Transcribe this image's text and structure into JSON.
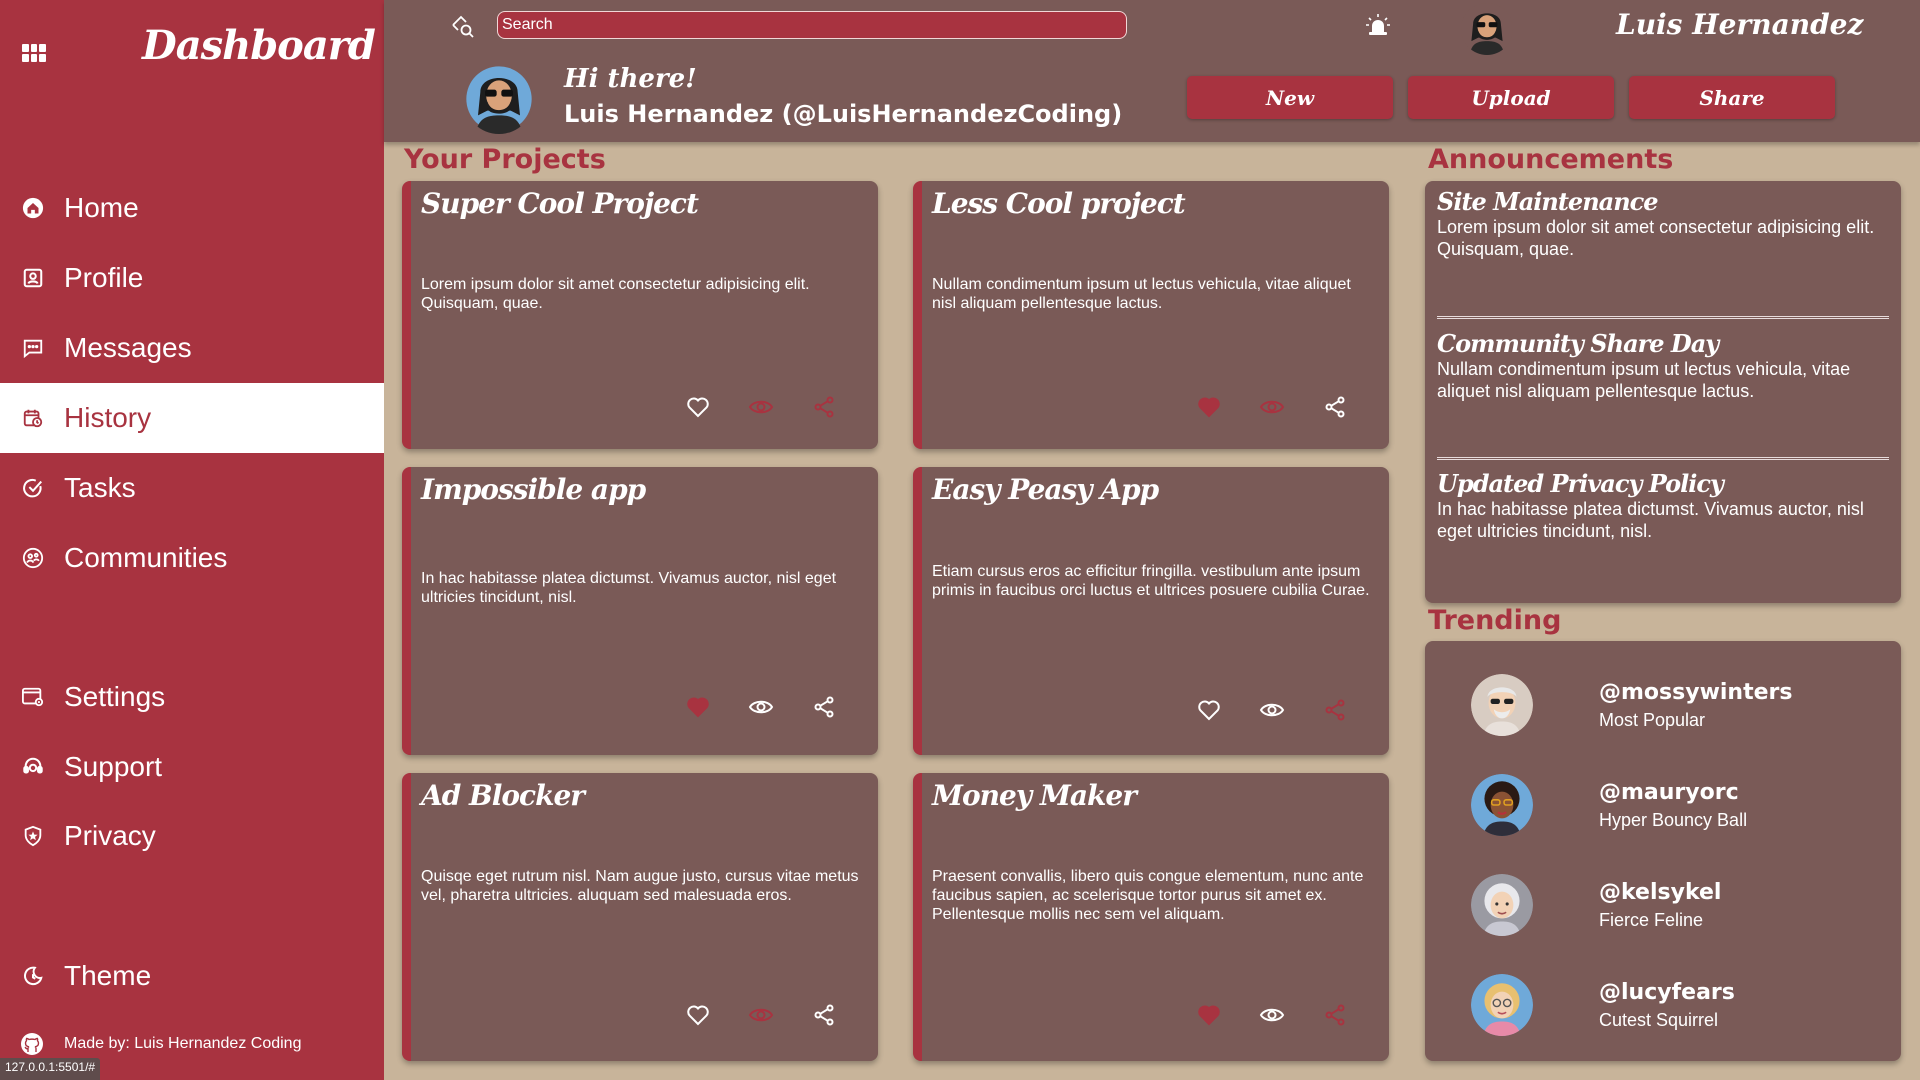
{
  "brand": {
    "title": "Dashboard"
  },
  "sidebar": {
    "items": [
      {
        "label": "Home",
        "icon": "home-icon"
      },
      {
        "label": "Profile",
        "icon": "profile-icon"
      },
      {
        "label": "Messages",
        "icon": "messages-icon"
      },
      {
        "label": "History",
        "icon": "history-icon",
        "active": true
      },
      {
        "label": "Tasks",
        "icon": "tasks-icon"
      },
      {
        "label": "Communities",
        "icon": "communities-icon"
      },
      {
        "label": "Settings",
        "icon": "settings-icon"
      },
      {
        "label": "Support",
        "icon": "support-icon"
      },
      {
        "label": "Privacy",
        "icon": "privacy-icon"
      },
      {
        "label": "Theme",
        "icon": "theme-icon"
      }
    ],
    "footer": "Made by: Luis Hernandez Coding"
  },
  "status_url": "127.0.0.1:5501/#",
  "header": {
    "search_placeholder": "Search",
    "user_name": "Luis Hernandez",
    "greeting": "Hi there!",
    "full_name": "Luis Hernandez (@LuisHernandezCoding)",
    "buttons": {
      "new": "New",
      "upload": "Upload",
      "share": "Share"
    }
  },
  "colors": {
    "accent": "#a83340",
    "panel": "#7a5a57",
    "background": "#c8b49a"
  },
  "projects": {
    "title": "Your Projects",
    "items": [
      {
        "title": "Super Cool Project",
        "description": "Lorem ipsum dolor sit amet consectetur adipisicing elit. Quisquam, quae.",
        "liked": false,
        "watched": true,
        "shared": true
      },
      {
        "title": "Less Cool project",
        "description": "Nullam condimentum ipsum ut lectus vehicula, vitae aliquet nisl aliquam pellentesque lactus.",
        "liked": true,
        "watched": true,
        "shared": false
      },
      {
        "title": "Impossible app",
        "description": "In hac habitasse platea dictumst. Vivamus auctor, nisl eget ultricies tincidunt, nisl.",
        "liked": true,
        "watched": false,
        "shared": false
      },
      {
        "title": "Easy Peasy App",
        "description": "Etiam cursus eros ac efficitur fringilla. vestibulum ante ipsum primis in faucibus orci luctus et ultrices posuere cubilia Curae.",
        "liked": false,
        "watched": false,
        "shared": true
      },
      {
        "title": "Ad Blocker",
        "description": "Quisqe eget rutrum nisl. Nam augue justo, cursus vitae metus vel, pharetra ultricies. aluquam sed malesuada eros.",
        "liked": false,
        "watched": true,
        "shared": false
      },
      {
        "title": "Money Maker",
        "description": "Praesent convallis, libero quis congue elementum, nunc ante faucibus sapien, ac scelerisque tortor purus sit amet ex. Pellentesque mollis nec sem vel aliquam.",
        "liked": true,
        "watched": false,
        "shared": true
      }
    ]
  },
  "announcements": {
    "title": "Announcements",
    "items": [
      {
        "title": "Site Maintenance",
        "text": "Lorem ipsum dolor sit amet consectetur adipisicing elit. Quisquam, quae."
      },
      {
        "title": "Community Share Day",
        "text": "Nullam condimentum ipsum ut lectus vehicula, vitae aliquet nisl aliquam pellentesque lactus."
      },
      {
        "title": "Updated Privacy Policy",
        "text": "In hac habitasse platea dictumst. Vivamus auctor, nisl eget ultricies tincidunt, nisl."
      }
    ]
  },
  "trending": {
    "title": "Trending",
    "items": [
      {
        "handle": "@mossywinters",
        "subtitle": "Most Popular"
      },
      {
        "handle": "@mauryorc",
        "subtitle": "Hyper Bouncy Ball"
      },
      {
        "handle": "@kelsykel",
        "subtitle": "Fierce Feline"
      },
      {
        "handle": "@lucyfears",
        "subtitle": "Cutest Squirrel"
      }
    ]
  }
}
